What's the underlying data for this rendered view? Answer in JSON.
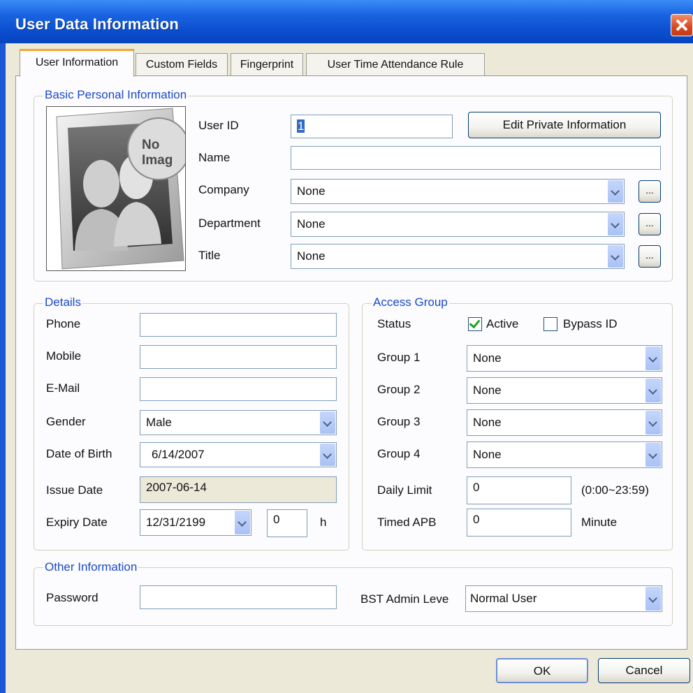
{
  "window": {
    "title": "User Data Information"
  },
  "tabs": [
    "User Information",
    "Custom Fields",
    "Fingerprint",
    "User Time Attendance Rule"
  ],
  "basic": {
    "group_title": "Basic Personal Information",
    "photo_text": "No Image",
    "user_id_label": "User ID",
    "user_id_value": "1",
    "edit_private_button": "Edit Private Information",
    "name_label": "Name",
    "name_value": "",
    "company_label": "Company",
    "company_value": "None",
    "department_label": "Department",
    "department_value": "None",
    "title_label": "Title",
    "title_value": "None",
    "browse_label": "..."
  },
  "details": {
    "group_title": "Details",
    "phone_label": "Phone",
    "phone_value": "",
    "mobile_label": "Mobile",
    "mobile_value": "",
    "email_label": "E-Mail",
    "email_value": "",
    "gender_label": "Gender",
    "gender_value": "Male",
    "dob_label": "Date of Birth",
    "dob_value": "6/14/2007",
    "issue_label": "Issue Date",
    "issue_value": "2007-06-14",
    "expiry_label": "Expiry Date",
    "expiry_value": "12/31/2199",
    "expiry_hour_value": "0",
    "hour_unit": "h"
  },
  "access": {
    "group_title": "Access Group",
    "status_label": "Status",
    "active_label": "Active",
    "active_checked": true,
    "bypass_label": "Bypass ID",
    "bypass_checked": false,
    "group1_label": "Group 1",
    "group1_value": "None",
    "group2_label": "Group 2",
    "group2_value": "None",
    "group3_label": "Group 3",
    "group3_value": "None",
    "group4_label": "Group 4",
    "group4_value": "None",
    "daily_limit_label": "Daily Limit",
    "daily_limit_value": "0",
    "daily_limit_range": "(0:00~23:59)",
    "timed_apb_label": "Timed APB",
    "timed_apb_value": "0",
    "timed_apb_unit": "Minute"
  },
  "other": {
    "group_title": "Other Information",
    "password_label": "Password",
    "password_value": "",
    "admin_level_label": "BST Admin Leve",
    "admin_level_value": "Normal User"
  },
  "buttons": {
    "ok": "OK",
    "cancel": "Cancel"
  }
}
